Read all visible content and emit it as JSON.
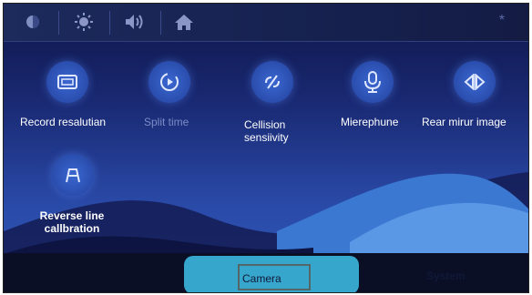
{
  "top_bar": {
    "icons": [
      "brightness-icon",
      "sun-icon",
      "volume-icon",
      "home-icon"
    ],
    "right_glyph": "*"
  },
  "features": [
    {
      "label": "Record resalutian",
      "icon": "resolution-icon",
      "enabled": true
    },
    {
      "label": "Split time",
      "icon": "split-time-icon",
      "enabled": false
    },
    {
      "label": "Cellision sensiivity",
      "icon": "collision-icon",
      "enabled": true
    },
    {
      "label": "Mierephune",
      "icon": "microphone-icon",
      "enabled": true
    },
    {
      "label": "Rear mirur image",
      "icon": "mirror-icon",
      "enabled": true
    },
    {
      "label": "Reverse line callbration",
      "icon": "reverse-line-icon",
      "enabled": true
    }
  ],
  "bottom_tabs": [
    {
      "label": "",
      "active": false
    },
    {
      "label": "Camera",
      "active": true
    },
    {
      "label": "System",
      "active": false
    }
  ],
  "colors": {
    "accent": "#37a6cc",
    "background": "#1a2a74",
    "icon_circle": "#2b4fb0"
  }
}
